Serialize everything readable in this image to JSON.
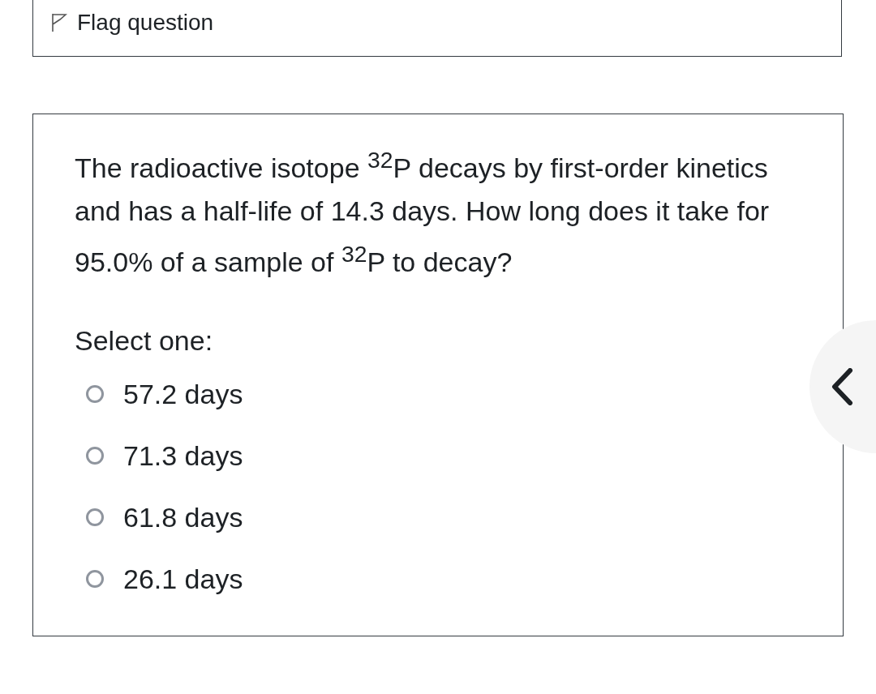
{
  "flag": {
    "label": "Flag question"
  },
  "question": {
    "text": "The radioactive isotope $^{32}$P decays by first-order kinetics and has a half-life of 14.3 days. How long does it take for 95.0% of a sample of $^{32}$P to decay?",
    "prompt": "Select one:",
    "options": [
      {
        "label": "57.2 days",
        "selected": false
      },
      {
        "label": "71.3 days",
        "selected": false
      },
      {
        "label": "61.8 days",
        "selected": false
      },
      {
        "label": "26.1 days",
        "selected": false
      }
    ]
  }
}
